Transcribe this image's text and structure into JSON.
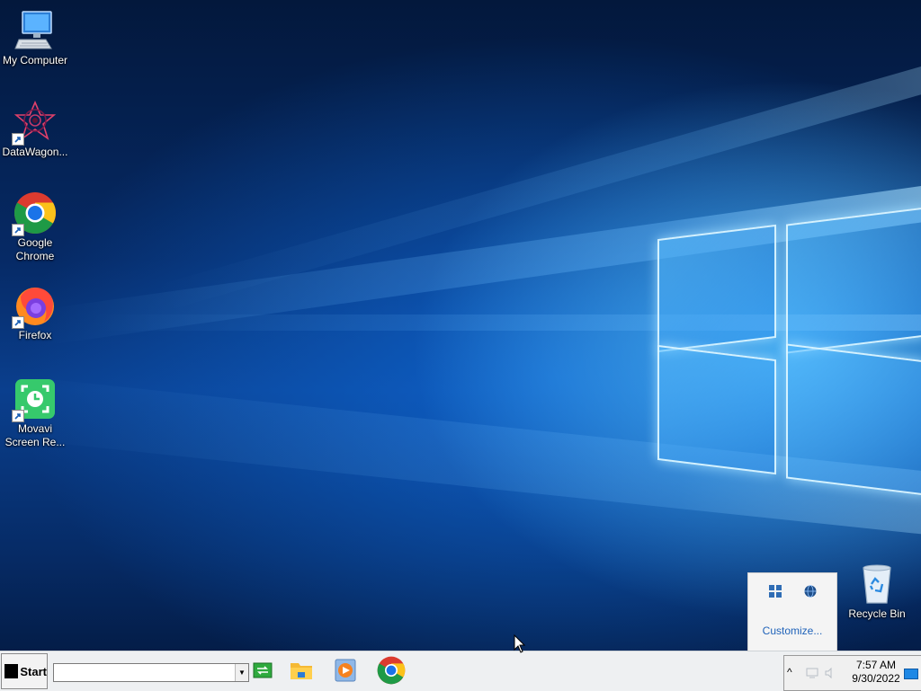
{
  "desktop": {
    "icons": [
      {
        "label": "My Computer",
        "icon": "my-computer-icon"
      },
      {
        "label": "DataWagon...",
        "icon": "datawagon-icon"
      },
      {
        "label": "Google Chrome",
        "icon": "chrome-icon"
      },
      {
        "label": "Firefox",
        "icon": "firefox-icon"
      },
      {
        "label": "Movavi Screen Re...",
        "icon": "movavi-icon"
      }
    ],
    "recycle_bin": {
      "label": "Recycle Bin",
      "icon": "recycle-bin-icon"
    }
  },
  "tray_popup": {
    "icons": [
      "windows-grid-icon",
      "globe-icon"
    ],
    "customize_label": "Customize..."
  },
  "taskbar": {
    "start_label": "Start",
    "address_value": "",
    "pinned": [
      "desktop-switch-icon",
      "file-explorer-icon",
      "media-player-icon",
      "chrome-icon"
    ],
    "tray": {
      "chevron": "^",
      "time": "7:57 AM",
      "date": "9/30/2022"
    }
  },
  "colors": {
    "taskbar_bg": "#eef0f2",
    "link_blue": "#1f62b9",
    "wallpaper_blue": "#0a3f8e"
  }
}
